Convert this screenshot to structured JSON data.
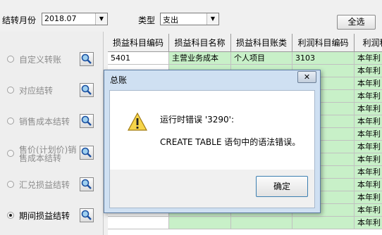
{
  "toolbar": {
    "period_label": "结转月份",
    "period_value": "2018.07",
    "type_label": "类型",
    "type_value": "支出",
    "select_all": "全选"
  },
  "options": [
    {
      "label": "自定义转账",
      "selected": false
    },
    {
      "label": "对应结转",
      "selected": false
    },
    {
      "label": "销售成本结转",
      "selected": false
    },
    {
      "label": "售价(计划价)销售成本结转",
      "selected": false
    },
    {
      "label": "汇兑损益结转",
      "selected": false
    },
    {
      "label": "期间损益结转",
      "selected": true
    }
  ],
  "grid": {
    "headers": [
      "损益科目编码",
      "损益科目名称",
      "损益科目账类",
      "利润科目编码",
      "利润科"
    ],
    "rows": [
      [
        "5401",
        "主营业务成本",
        "个人项目",
        "3103",
        "本年利"
      ],
      [
        "",
        "",
        "",
        "",
        "本年利"
      ],
      [
        "",
        "",
        "",
        "",
        "本年利"
      ],
      [
        "",
        "",
        "",
        "",
        "本年利"
      ],
      [
        "",
        "",
        "",
        "",
        "本年利"
      ],
      [
        "",
        "",
        "",
        "",
        "本年利"
      ],
      [
        "",
        "",
        "",
        "",
        "本年利"
      ],
      [
        "",
        "",
        "",
        "",
        "本年利"
      ],
      [
        "",
        "",
        "",
        "",
        "本年利"
      ],
      [
        "",
        "",
        "",
        "",
        "本年利"
      ],
      [
        "",
        "",
        "",
        "",
        "本年利"
      ],
      [
        "",
        "",
        "",
        "",
        "本年利"
      ],
      [
        "",
        "",
        "",
        "",
        "本年利"
      ],
      [
        "",
        "",
        "",
        "",
        "本年利"
      ]
    ]
  },
  "dialog": {
    "title": "总账",
    "close": "✕",
    "line1": "运行时错误 '3290':",
    "line2": "CREATE TABLE 语句中的语法错误。",
    "ok": "确定"
  }
}
